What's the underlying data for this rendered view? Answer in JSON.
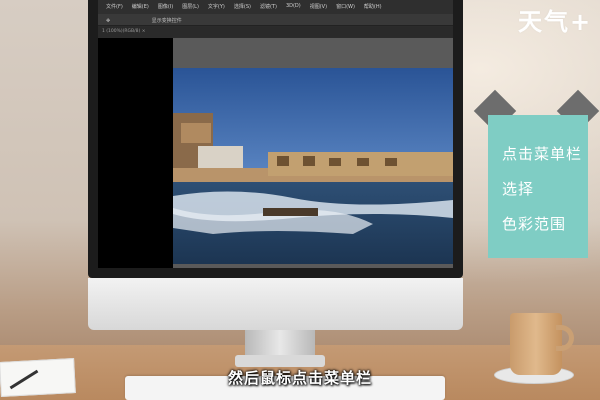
{
  "brand": {
    "logo_text": "天气+"
  },
  "photoshop": {
    "menu_items": [
      "文件(F)",
      "编辑(E)",
      "图像(I)",
      "图层(L)",
      "文字(Y)",
      "选择(S)",
      "滤镜(T)",
      "3D(D)",
      "视图(V)",
      "窗口(W)",
      "帮助(H)"
    ],
    "options_label": "显示变换控件",
    "tab_label": "1 (100%)(RGB/8) ×"
  },
  "instruction_panel": {
    "items": [
      "点击菜单栏",
      "选择",
      "色彩范围"
    ],
    "accent_color": "#7fcdc4"
  },
  "subtitle": "然后鼠标点击菜单栏"
}
